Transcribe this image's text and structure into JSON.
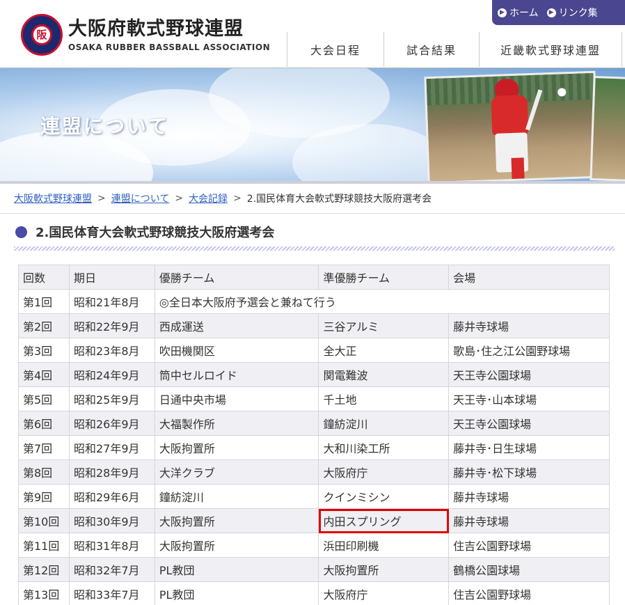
{
  "header": {
    "logo_jp": "大阪府軟式野球連盟",
    "logo_en": "OSAKA RUBBER BASSBALL ASSOCIATION",
    "logo_mark": "阪",
    "top_links": [
      "ホーム",
      "リンク集"
    ],
    "nav": [
      "大会日程",
      "試合結果",
      "近畿軟式野球連盟"
    ]
  },
  "banner": {
    "title": "連盟について"
  },
  "breadcrumb": {
    "links": [
      "大阪軟式野球連盟",
      "連盟について",
      "大会記録"
    ],
    "current": "2.国民体育大会軟式野球競技大阪府選考会",
    "separator": ">"
  },
  "page": {
    "heading": "2.国民体育大会軟式野球競技大阪府選考会"
  },
  "table": {
    "headers": [
      "回数",
      "期日",
      "優勝チーム",
      "準優勝チーム",
      "会場"
    ],
    "rows": [
      {
        "round": "第1回",
        "date": "昭和21年8月",
        "winner": "◎全日本大阪府予選会と兼ねて行う",
        "runner_up": "",
        "venue": ""
      },
      {
        "round": "第2回",
        "date": "昭和22年9月",
        "winner": "西成運送",
        "runner_up": "三谷アルミ",
        "venue": "藤井寺球場"
      },
      {
        "round": "第3回",
        "date": "昭和23年8月",
        "winner": "吹田機関区",
        "runner_up": "全大正",
        "venue": "歌島･住之江公園野球場"
      },
      {
        "round": "第4回",
        "date": "昭和24年9月",
        "winner": "筒中セルロイド",
        "runner_up": "関電難波",
        "venue": "天王寺公園球場"
      },
      {
        "round": "第5回",
        "date": "昭和25年9月",
        "winner": "日通中央市場",
        "runner_up": "千土地",
        "venue": "天王寺･山本球場"
      },
      {
        "round": "第6回",
        "date": "昭和26年9月",
        "winner": "大福製作所",
        "runner_up": "鐘紡淀川",
        "venue": "天王寺公園球場"
      },
      {
        "round": "第7回",
        "date": "昭和27年9月",
        "winner": "大阪拘置所",
        "runner_up": "大和川染工所",
        "venue": "藤井寺･日生球場"
      },
      {
        "round": "第8回",
        "date": "昭和28年9月",
        "winner": "大洋クラブ",
        "runner_up": "大阪府庁",
        "venue": "藤井寺･松下球場"
      },
      {
        "round": "第9回",
        "date": "昭和29年6月",
        "winner": "鐘紡淀川",
        "runner_up": "クインミシン",
        "venue": "藤井寺球場"
      },
      {
        "round": "第10回",
        "date": "昭和30年9月",
        "winner": "大阪拘置所",
        "runner_up": "内田スプリング",
        "venue": "藤井寺球場"
      },
      {
        "round": "第11回",
        "date": "昭和31年8月",
        "winner": "大阪拘置所",
        "runner_up": "浜田印刷機",
        "venue": "住吉公園野球場"
      },
      {
        "round": "第12回",
        "date": "昭和32年7月",
        "winner": "PL教団",
        "runner_up": "大阪拘置所",
        "venue": "鶴橋公園球場"
      },
      {
        "round": "第13回",
        "date": "昭和33年7月",
        "winner": "PL教団",
        "runner_up": "大阪府庁",
        "venue": "住吉公園野球場"
      }
    ]
  },
  "colors": {
    "accent": "#4a4690",
    "link": "#2f5fc0",
    "highlight": "#e00000"
  }
}
